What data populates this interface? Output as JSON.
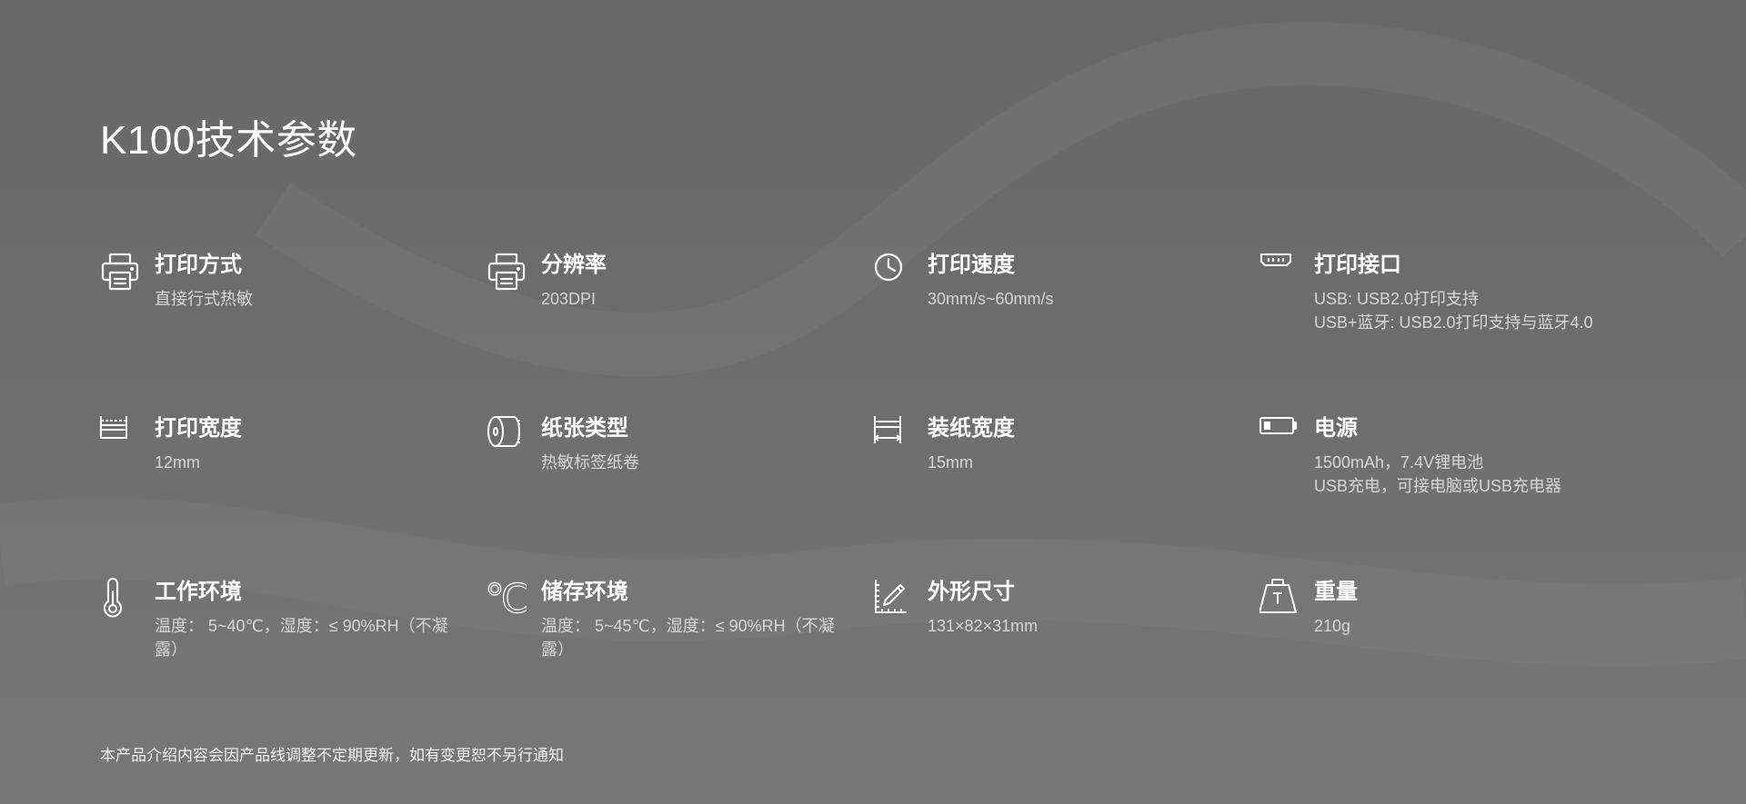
{
  "page": {
    "title": "K100技术参数",
    "footer_note": "本产品介绍内容会因产品线调整不定期更新，如有变更恕不另行通知"
  },
  "specs": [
    {
      "icon": "printer-icon",
      "title": "打印方式",
      "lines": [
        "直接行式热敏"
      ]
    },
    {
      "icon": "printer-icon",
      "title": "分辨率",
      "lines": [
        "203DPI"
      ]
    },
    {
      "icon": "clock-icon",
      "title": "打印速度",
      "lines": [
        "30mm/s~60mm/s"
      ]
    },
    {
      "icon": "usb-port-icon",
      "title": "打印接口",
      "lines": [
        "USB: USB2.0打印支持",
        "USB+蓝牙: USB2.0打印支持与蓝牙4.0"
      ]
    },
    {
      "icon": "print-width-icon",
      "title": "打印宽度",
      "lines": [
        "12mm"
      ]
    },
    {
      "icon": "paper-roll-icon",
      "title": "纸张类型",
      "lines": [
        "热敏标签纸卷"
      ]
    },
    {
      "icon": "paper-width-icon",
      "title": "装纸宽度",
      "lines": [
        "15mm"
      ]
    },
    {
      "icon": "battery-icon",
      "title": "电源",
      "lines": [
        "1500mAh，7.4V锂电池",
        "USB充电，可接电脑或USB充电器"
      ]
    },
    {
      "icon": "thermometer-icon",
      "title": "工作环境",
      "lines": [
        "温度： 5~40℃，湿度：≤ 90%RH（不凝露）"
      ]
    },
    {
      "icon": "celsius-icon",
      "title": "储存环境",
      "lines": [
        "温度： 5~45℃，湿度：≤ 90%RH（不凝露）"
      ]
    },
    {
      "icon": "ruler-pencil-icon",
      "title": "外形尺寸",
      "lines": [
        "131×82×31mm"
      ]
    },
    {
      "icon": "weight-icon",
      "title": "重量",
      "lines": [
        "210g"
      ]
    }
  ],
  "icon_glyphs": {
    "celsius": "℃"
  },
  "colors": {
    "background_top": "#686868",
    "background_bottom": "#777777",
    "title_text": "#ffffff",
    "value_text": "#d6d6d6"
  }
}
